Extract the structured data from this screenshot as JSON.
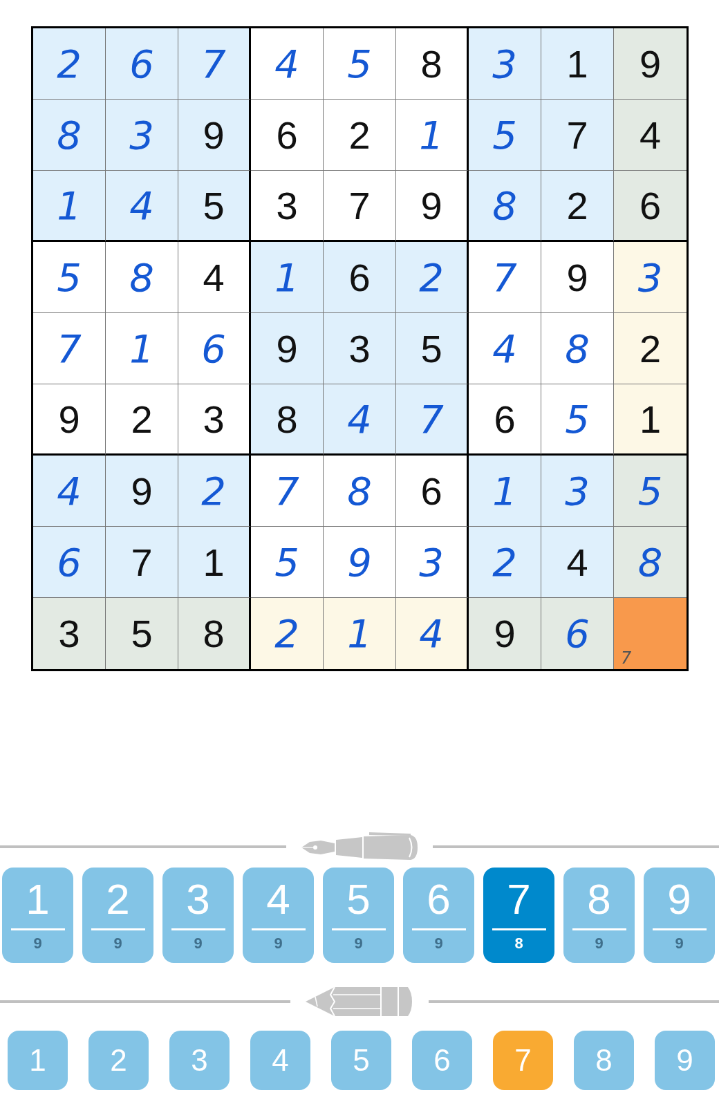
{
  "board": {
    "rows": [
      [
        {
          "value": "2",
          "given": false,
          "selected": false
        },
        {
          "value": "6",
          "given": false,
          "selected": false
        },
        {
          "value": "7",
          "given": false,
          "selected": false
        },
        {
          "value": "4",
          "given": false,
          "selected": false
        },
        {
          "value": "5",
          "given": false,
          "selected": false
        },
        {
          "value": "8",
          "given": true,
          "selected": false
        },
        {
          "value": "3",
          "given": false,
          "selected": false
        },
        {
          "value": "1",
          "given": true,
          "selected": false
        },
        {
          "value": "9",
          "given": true,
          "selected": false
        }
      ],
      [
        {
          "value": "8",
          "given": false,
          "selected": false
        },
        {
          "value": "3",
          "given": false,
          "selected": false
        },
        {
          "value": "9",
          "given": true,
          "selected": false
        },
        {
          "value": "6",
          "given": true,
          "selected": false
        },
        {
          "value": "2",
          "given": true,
          "selected": false
        },
        {
          "value": "1",
          "given": false,
          "selected": false
        },
        {
          "value": "5",
          "given": false,
          "selected": false
        },
        {
          "value": "7",
          "given": true,
          "selected": false
        },
        {
          "value": "4",
          "given": true,
          "selected": false
        }
      ],
      [
        {
          "value": "1",
          "given": false,
          "selected": false
        },
        {
          "value": "4",
          "given": false,
          "selected": false
        },
        {
          "value": "5",
          "given": true,
          "selected": false
        },
        {
          "value": "3",
          "given": true,
          "selected": false
        },
        {
          "value": "7",
          "given": true,
          "selected": false
        },
        {
          "value": "9",
          "given": true,
          "selected": false
        },
        {
          "value": "8",
          "given": false,
          "selected": false
        },
        {
          "value": "2",
          "given": true,
          "selected": false
        },
        {
          "value": "6",
          "given": true,
          "selected": false
        }
      ],
      [
        {
          "value": "5",
          "given": false,
          "selected": false
        },
        {
          "value": "8",
          "given": false,
          "selected": false
        },
        {
          "value": "4",
          "given": true,
          "selected": false
        },
        {
          "value": "1",
          "given": false,
          "selected": false
        },
        {
          "value": "6",
          "given": true,
          "selected": false
        },
        {
          "value": "2",
          "given": false,
          "selected": false
        },
        {
          "value": "7",
          "given": false,
          "selected": false
        },
        {
          "value": "9",
          "given": true,
          "selected": false
        },
        {
          "value": "3",
          "given": false,
          "selected": false
        }
      ],
      [
        {
          "value": "7",
          "given": false,
          "selected": false
        },
        {
          "value": "1",
          "given": false,
          "selected": false
        },
        {
          "value": "6",
          "given": false,
          "selected": false
        },
        {
          "value": "9",
          "given": true,
          "selected": false
        },
        {
          "value": "3",
          "given": true,
          "selected": false
        },
        {
          "value": "5",
          "given": true,
          "selected": false
        },
        {
          "value": "4",
          "given": false,
          "selected": false
        },
        {
          "value": "8",
          "given": false,
          "selected": false
        },
        {
          "value": "2",
          "given": true,
          "selected": false
        }
      ],
      [
        {
          "value": "9",
          "given": true,
          "selected": false
        },
        {
          "value": "2",
          "given": true,
          "selected": false
        },
        {
          "value": "3",
          "given": true,
          "selected": false
        },
        {
          "value": "8",
          "given": true,
          "selected": false
        },
        {
          "value": "4",
          "given": false,
          "selected": false
        },
        {
          "value": "7",
          "given": false,
          "selected": false
        },
        {
          "value": "6",
          "given": true,
          "selected": false
        },
        {
          "value": "5",
          "given": false,
          "selected": false
        },
        {
          "value": "1",
          "given": true,
          "selected": false
        }
      ],
      [
        {
          "value": "4",
          "given": false,
          "selected": false
        },
        {
          "value": "9",
          "given": true,
          "selected": false
        },
        {
          "value": "2",
          "given": false,
          "selected": false
        },
        {
          "value": "7",
          "given": false,
          "selected": false
        },
        {
          "value": "8",
          "given": false,
          "selected": false
        },
        {
          "value": "6",
          "given": true,
          "selected": false
        },
        {
          "value": "1",
          "given": false,
          "selected": false
        },
        {
          "value": "3",
          "given": false,
          "selected": false
        },
        {
          "value": "5",
          "given": false,
          "selected": false
        }
      ],
      [
        {
          "value": "6",
          "given": false,
          "selected": false
        },
        {
          "value": "7",
          "given": true,
          "selected": false
        },
        {
          "value": "1",
          "given": true,
          "selected": false
        },
        {
          "value": "5",
          "given": false,
          "selected": false
        },
        {
          "value": "9",
          "given": false,
          "selected": false
        },
        {
          "value": "3",
          "given": false,
          "selected": false
        },
        {
          "value": "2",
          "given": false,
          "selected": false
        },
        {
          "value": "4",
          "given": true,
          "selected": false
        },
        {
          "value": "8",
          "given": false,
          "selected": false
        }
      ],
      [
        {
          "value": "3",
          "given": true,
          "selected": false
        },
        {
          "value": "5",
          "given": true,
          "selected": false
        },
        {
          "value": "8",
          "given": true,
          "selected": false
        },
        {
          "value": "2",
          "given": false,
          "selected": false
        },
        {
          "value": "1",
          "given": false,
          "selected": false
        },
        {
          "value": "4",
          "given": false,
          "selected": false
        },
        {
          "value": "9",
          "given": true,
          "selected": false
        },
        {
          "value": "6",
          "given": false,
          "selected": false
        },
        {
          "notes": [
            "7"
          ],
          "given": false,
          "selected": true
        }
      ]
    ]
  },
  "pen_pad": {
    "buttons": [
      {
        "digit": "1",
        "count": "9",
        "selected": false
      },
      {
        "digit": "2",
        "count": "9",
        "selected": false
      },
      {
        "digit": "3",
        "count": "9",
        "selected": false
      },
      {
        "digit": "4",
        "count": "9",
        "selected": false
      },
      {
        "digit": "5",
        "count": "9",
        "selected": false
      },
      {
        "digit": "6",
        "count": "9",
        "selected": false
      },
      {
        "digit": "7",
        "count": "8",
        "selected": true
      },
      {
        "digit": "8",
        "count": "9",
        "selected": false
      },
      {
        "digit": "9",
        "count": "9",
        "selected": false
      }
    ]
  },
  "pencil_pad": {
    "buttons": [
      {
        "digit": "1",
        "selected": false
      },
      {
        "digit": "2",
        "selected": false
      },
      {
        "digit": "3",
        "selected": false
      },
      {
        "digit": "4",
        "selected": false
      },
      {
        "digit": "5",
        "selected": false
      },
      {
        "digit": "6",
        "selected": false
      },
      {
        "digit": "7",
        "selected": true
      },
      {
        "digit": "8",
        "selected": false
      },
      {
        "digit": "9",
        "selected": false
      }
    ]
  }
}
